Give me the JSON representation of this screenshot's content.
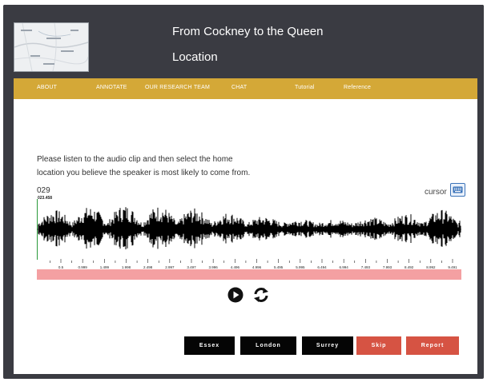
{
  "header": {
    "title": "From Cockney to the Queen",
    "subtitle": "Location"
  },
  "nav": {
    "items": [
      {
        "label": "ABOUT"
      },
      {
        "label": "ANNOTATE"
      },
      {
        "label": "OUR RESEARCH TEAM"
      },
      {
        "label": "CHAT"
      },
      {
        "label": "Tutorial"
      },
      {
        "label": "Reference"
      }
    ]
  },
  "main": {
    "instruction_line1": "Please listen to the audio clip and then select the home",
    "instruction_line2": "location you believe the speaker is most likely to come from.",
    "clip_id": "029",
    "cursor_label": "cursor",
    "time_marker": "023.458",
    "ruler_ticks": [
      "0.5",
      "0.999",
      "1.499",
      "1.998",
      "2.498",
      "2.997",
      "3.497",
      "3.996",
      "4.496",
      "4.996",
      "5.495",
      "5.995",
      "6.494",
      "6.994",
      "7.493",
      "7.993",
      "8.492",
      "8.992",
      "9.491"
    ],
    "progress_color": "#f4a0a2"
  },
  "controls": {
    "play_icon": "play-icon",
    "replay_icon": "refresh-icon"
  },
  "buttons": {
    "essex": "Essex",
    "london": "London",
    "surrey": "Surrey",
    "skip": "Skip",
    "report": "Report"
  },
  "colors": {
    "header_bg": "#3a3b42",
    "nav_bg": "#d4a837",
    "skip_bg": "#d65343",
    "report_bg": "#d65343",
    "location_bg": "#050505"
  }
}
